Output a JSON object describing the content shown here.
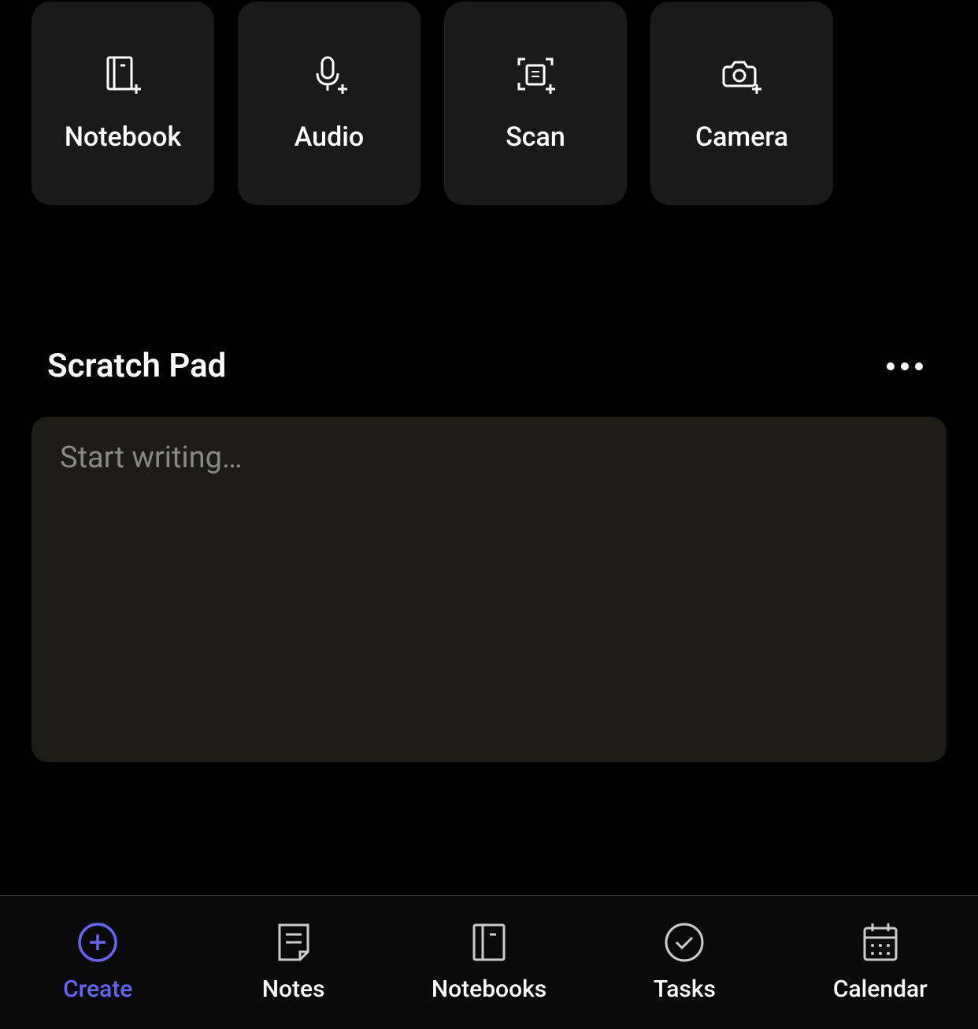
{
  "quickActions": [
    {
      "label": "Notebook",
      "icon": "notebook-plus-icon"
    },
    {
      "label": "Audio",
      "icon": "microphone-plus-icon"
    },
    {
      "label": "Scan",
      "icon": "scan-plus-icon"
    },
    {
      "label": "Camera",
      "icon": "camera-plus-icon"
    }
  ],
  "scratchPad": {
    "title": "Scratch Pad",
    "placeholder": "Start writing…"
  },
  "bottomNav": [
    {
      "label": "Create",
      "icon": "plus-circle-icon",
      "active": true
    },
    {
      "label": "Notes",
      "icon": "note-icon",
      "active": false
    },
    {
      "label": "Notebooks",
      "icon": "notebook-icon",
      "active": false
    },
    {
      "label": "Tasks",
      "icon": "check-circle-icon",
      "active": false
    },
    {
      "label": "Calendar",
      "icon": "calendar-icon",
      "active": false
    }
  ],
  "colors": {
    "accent": "#6366f1",
    "cardBg": "#1a1a1a",
    "scratchBg": "#1c1c14"
  }
}
